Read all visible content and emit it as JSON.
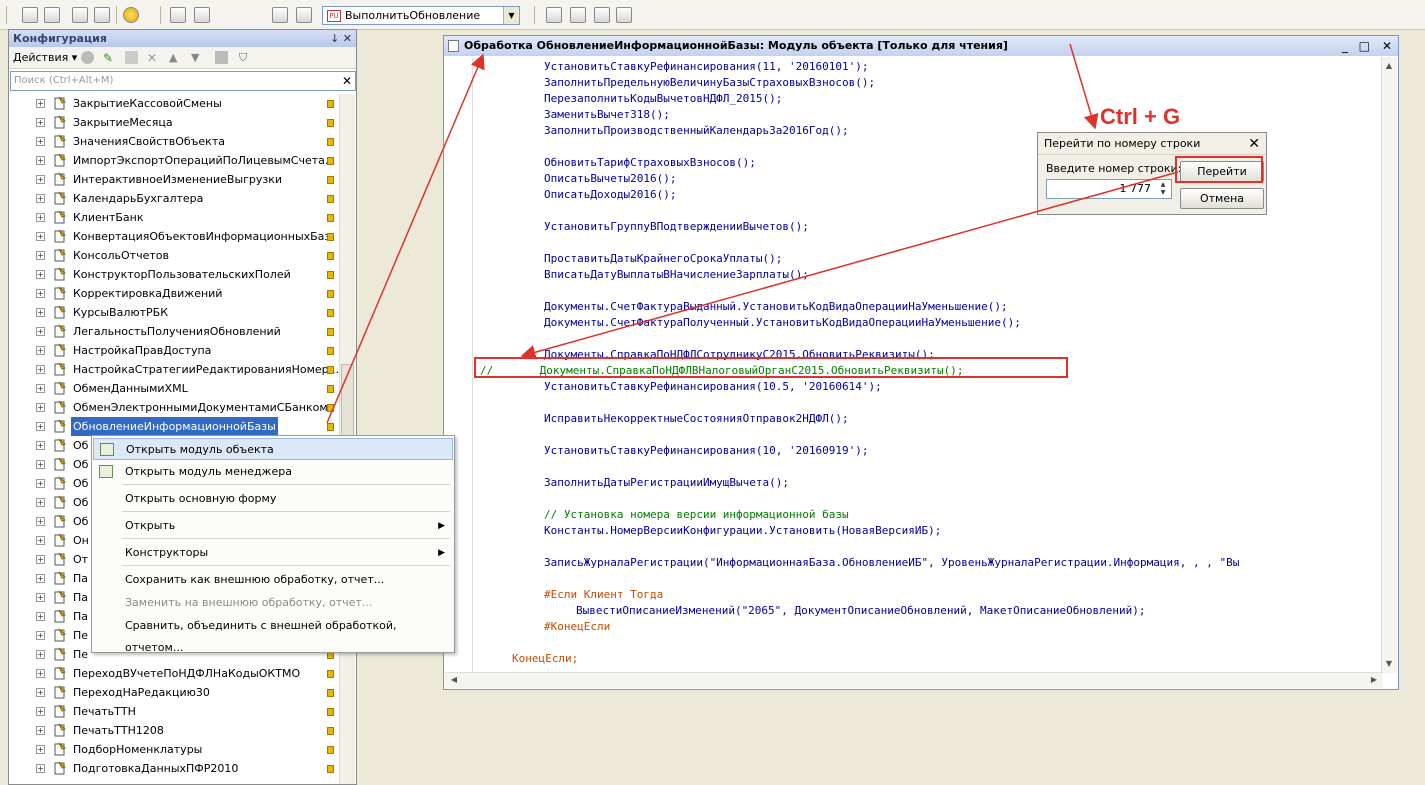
{
  "toolbar": {
    "config_combo": "ВыполнитьОбновление",
    "combo_logo": "PU"
  },
  "left_panel": {
    "title": "Конфигурация",
    "title_controls": "↓  ✕",
    "actions_label": "Действия ▾",
    "search_placeholder": "Поиск (Ctrl+Alt+M)",
    "items": [
      {
        "label": "ЗакрытиеКассовойСмены"
      },
      {
        "label": "ЗакрытиеМесяца"
      },
      {
        "label": "ЗначенияСвойствОбъекта"
      },
      {
        "label": "ИмпортЭкспортОперацийПоЛицевымСчета..."
      },
      {
        "label": "ИнтерактивноеИзменениеВыгрузки"
      },
      {
        "label": "КалендарьБухгалтера"
      },
      {
        "label": "КлиентБанк"
      },
      {
        "label": "КонвертацияОбъектовИнформационныхБаз"
      },
      {
        "label": "КонсольОтчетов"
      },
      {
        "label": "КонструкторПользовательскихПолей"
      },
      {
        "label": "КорректировкаДвижений"
      },
      {
        "label": "КурсыВалютРБК"
      },
      {
        "label": "ЛегальностьПолученияОбновлений"
      },
      {
        "label": "НастройкаПравДоступа"
      },
      {
        "label": "НастройкаСтратегииРедактированияНомер..."
      },
      {
        "label": "ОбменДаннымиXML"
      },
      {
        "label": "ОбменЭлектроннымиДокументамиСБанком"
      },
      {
        "label": "ОбновлениеИнформационнойБазы"
      },
      {
        "label": "Об"
      },
      {
        "label": "Об"
      },
      {
        "label": "Об"
      },
      {
        "label": "Об"
      },
      {
        "label": "Об"
      },
      {
        "label": "Он"
      },
      {
        "label": "От"
      },
      {
        "label": "Па"
      },
      {
        "label": "Па"
      },
      {
        "label": "Па"
      },
      {
        "label": "Пе"
      },
      {
        "label": "Пе"
      },
      {
        "label": "ПереходВУчетеПоНДФЛНаКодыОКТМО"
      },
      {
        "label": "ПереходНаРедакцию30"
      },
      {
        "label": "ПечатьТТН"
      },
      {
        "label": "ПечатьТТН1208"
      },
      {
        "label": "ПодборНоменклатуры"
      },
      {
        "label": "ПодготовкаДанныхПФР2010"
      }
    ]
  },
  "context_menu": {
    "items": [
      {
        "label": "Открыть модуль объекта"
      },
      {
        "label": "Открыть модуль менеджера"
      },
      {
        "label": "Открыть основную форму"
      },
      {
        "label": "Открыть"
      },
      {
        "label": "Конструкторы"
      },
      {
        "label": "Сохранить как внешнюю обработку, отчет..."
      },
      {
        "label": "Заменить на внешнюю обработку, отчет..."
      },
      {
        "label": "Сравнить, объединить с внешней обработкой, отчетом..."
      }
    ]
  },
  "editor": {
    "title": "Обработка ОбновлениеИнформационнойБазы: Модуль объекта [Только для чтения]",
    "window_controls": [
      "_",
      "□",
      "✕"
    ],
    "lines": [
      "УстановитьСтавкуРефинансирования(11, '20160101');",
      "ЗаполнитьПредельнуюВеличинуБазыСтраховыхВзносов();",
      "ПерезаполнитьКодыВычетовНДФЛ_2015();",
      "ЗаменитьВычет318();",
      "ЗаполнитьПроизводственныйКалендарьЗа2016Год();",
      "ОбновитьТарифСтраховыхВзносов();",
      "ОписатьВычеты2016();",
      "ОписатьДоходы2016();",
      "УстановитьГруппуВПодтвержденииВычетов();",
      "ПроставитьДатыКрайнегоСрокаУплаты();",
      "ВписатьДатуВыплатыВНачислениеЗарплаты();",
      "Документы.СчетФактураВыданный.УстановитьКодВидаОперацииНаУменьшение();",
      "Документы.СчетФактураПолученный.УстановитьКодВидаОперацииНаУменьшение();",
      "Документы.СправкаПоНДФЛСотрудникуС2015.ОбновитьРеквизиты();",
      "//       Документы.СправкаПоНДФЛВНалоговыйОрганС2015.ОбновитьРеквизиты();",
      "УстановитьСтавкуРефинансирования(10.5, '20160614');",
      "ИсправитьНекорректныеСостоянияОтправок2НДФЛ();",
      "УстановитьСтавкуРефинансирования(10, '20160919');",
      "ЗаполнитьДатыРегистрацииИмущВычета();",
      "// Установка номера версии информационной базы",
      "Константы.НомерВерсииКонфигурации.Установить(НоваяВерсияИБ);",
      "ЗаписьЖурналаРегистрации(\"ИнформационнаяБаза.ОбновлениеИБ\", УровеньЖурналаРегистрации.Информация, , , \"Вы",
      "#Если Клиент Тогда",
      "ВывестиОписаниеИзменений(\"2065\", ДокументОписаниеОбновлений, МакетОписаниеОбновлений);",
      "#КонецЕсли",
      "КонецЕсли;"
    ]
  },
  "goto_dialog": {
    "title": "Перейти по номеру строки",
    "label": "Введите номер строки:",
    "value": "1 777",
    "go_button": "Перейти",
    "cancel_button": "Отмена"
  },
  "annotation": "Ctrl + G",
  "colors": {
    "highlight": "#e0322b",
    "code_blue": "#00009c",
    "comment_green": "#008000",
    "preproc_orange": "#c84a00"
  }
}
